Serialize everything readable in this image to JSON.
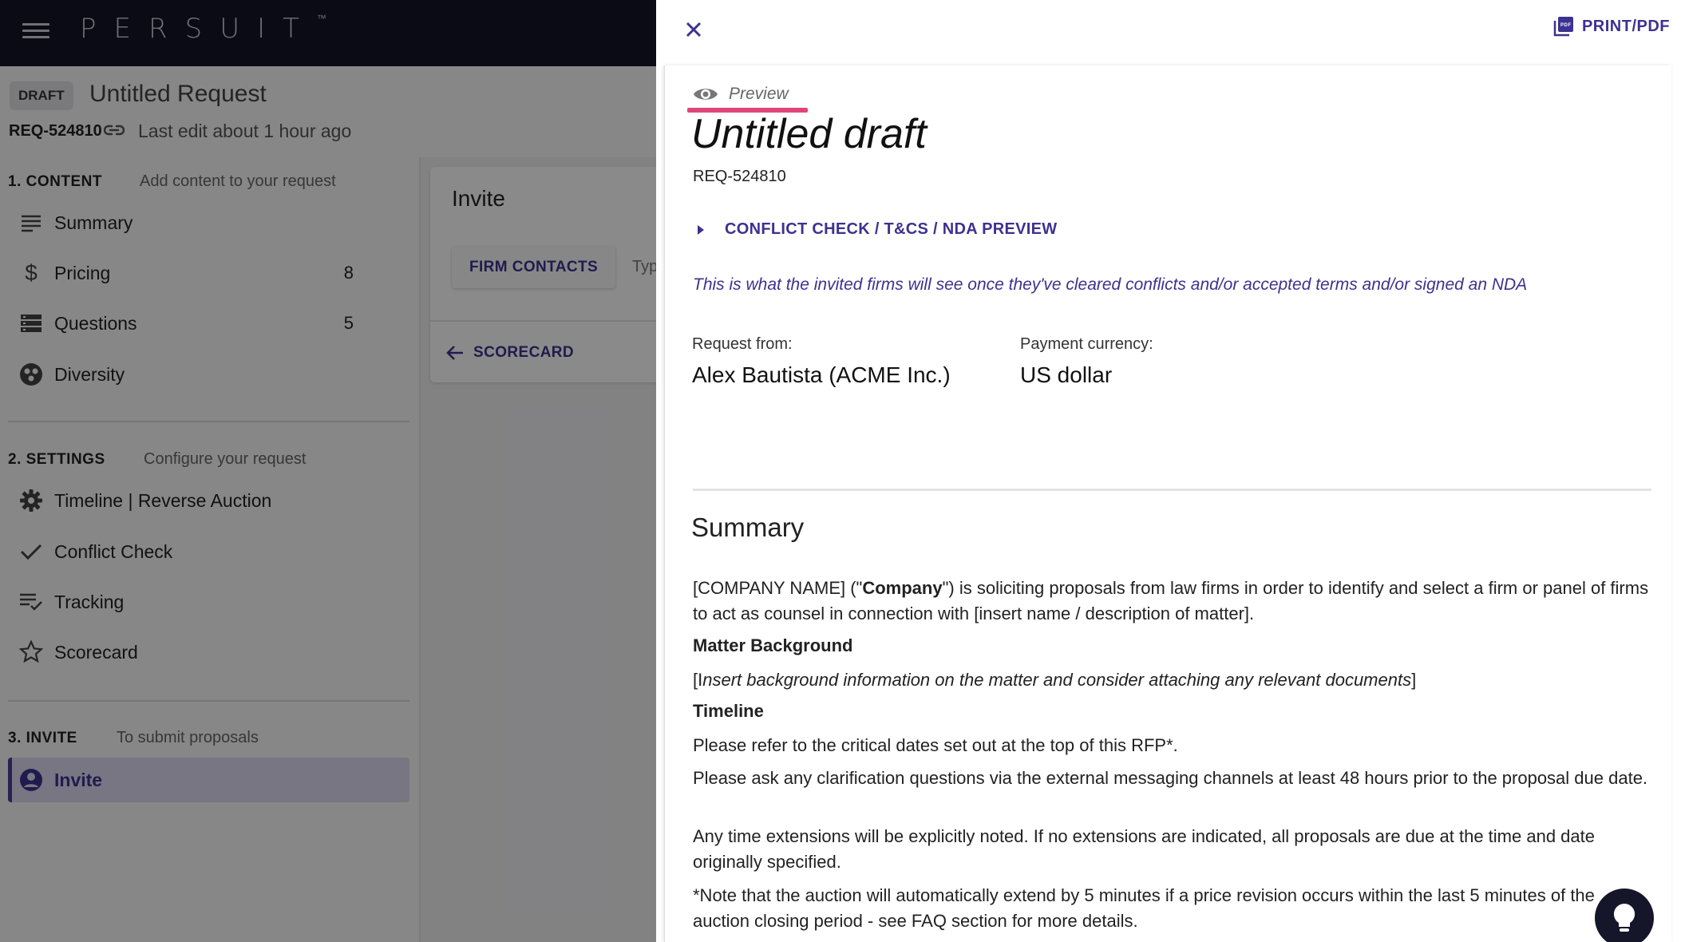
{
  "app": {
    "logo": "PERSUIT",
    "logo_tm": "™",
    "draft_badge": "DRAFT",
    "request_title": "Untitled Request",
    "request_id": "REQ-524810",
    "last_edit": "Last edit about 1 hour ago"
  },
  "sidebar": {
    "sections": [
      {
        "heading": "1. CONTENT",
        "subtitle": "Add content to your request",
        "items": [
          {
            "label": "Summary",
            "icon": "summary-lines-icon",
            "count": ""
          },
          {
            "label": "Pricing",
            "icon": "dollar-icon",
            "count": "8"
          },
          {
            "label": "Questions",
            "icon": "questions-list-icon",
            "count": "5"
          },
          {
            "label": "Diversity",
            "icon": "diversity-icon",
            "count": ""
          }
        ]
      },
      {
        "heading": "2. SETTINGS",
        "subtitle": "Configure your request",
        "items": [
          {
            "label": "Timeline | Reverse Auction",
            "icon": "gear-icon"
          },
          {
            "label": "Conflict Check",
            "icon": "check-icon"
          },
          {
            "label": "Tracking",
            "icon": "tracking-icon"
          },
          {
            "label": "Scorecard",
            "icon": "star-icon"
          }
        ]
      },
      {
        "heading": "3. INVITE",
        "subtitle": "To submit proposals",
        "items": [
          {
            "label": "Invite",
            "icon": "account-icon",
            "active": true
          }
        ]
      }
    ]
  },
  "main": {
    "card_title": "Invite",
    "firm_contacts_button": "FIRM CONTACTS",
    "type_hint": "Type",
    "scorecard_link": "SCORECARD"
  },
  "drawer": {
    "print_label": "PRINT/PDF",
    "preview_label": "Preview",
    "title": "Untitled draft",
    "request_id": "REQ-524810",
    "conflict_link": "CONFLICT CHECK / T&CS / NDA PREVIEW",
    "note": "This is what the invited firms will see once they've cleared conflicts and/or accepted terms and/or signed an NDA",
    "request_from_label": "Request from:",
    "request_from_value": "Alex Bautista (ACME Inc.)",
    "currency_label": "Payment currency:",
    "currency_value": "US dollar",
    "summary_heading": "Summary",
    "summary": {
      "intro_prefix": "[COMPANY NAME] (\"",
      "intro_bold": "Company",
      "intro_suffix": "\") is soliciting proposals from law firms in order to identify and select a firm or panel of firms to act as counsel in connection with [insert name / description of matter].",
      "matter_heading": "Matter Background",
      "matter_open": "[I",
      "matter_italic": "nsert background information on the matter and consider attaching any relevant documents",
      "matter_close": "]",
      "timeline_heading": "Timeline",
      "timeline_p1": "Please refer to the critical dates set out at the top of this RFP*.",
      "timeline_p2": "Please ask any clarification questions via the external messaging channels at least 48 hours prior to the proposal due date.",
      "timeline_p3": "Any time extensions will be explicitly noted. If no extensions are indicated, all proposals are due at the time and date originally specified.",
      "timeline_p4": "*Note that the auction will automatically extend by 5 minutes if a price revision occurs within the last 5 minutes of the auction closing period - see FAQ section for more details."
    }
  },
  "colors": {
    "accent": "#3c3290",
    "topbar": "#15162a",
    "preview_underline": "#e0457b"
  }
}
